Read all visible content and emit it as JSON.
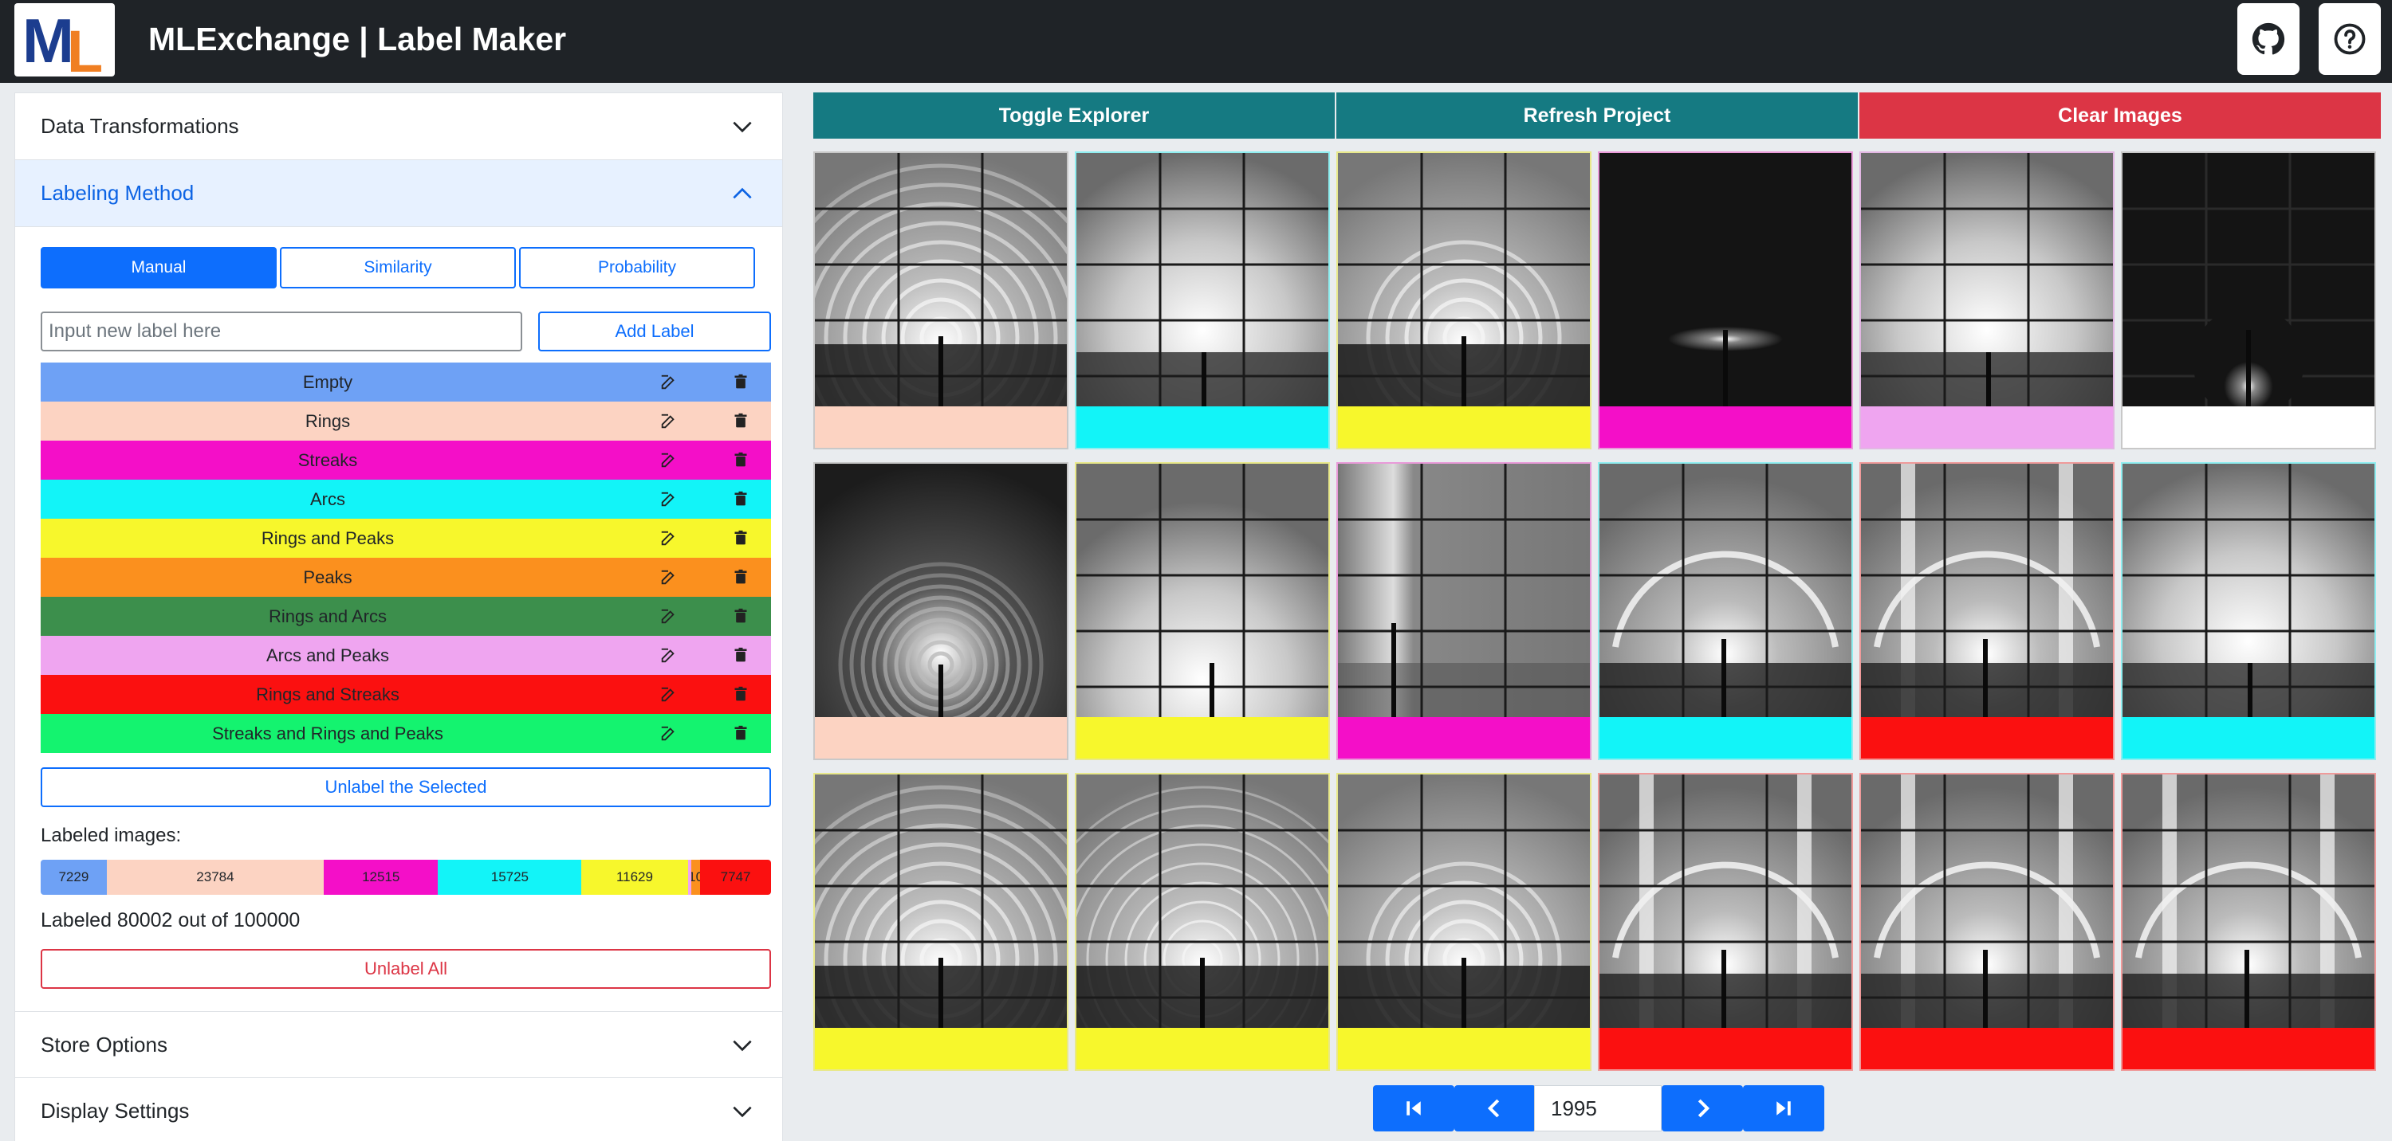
{
  "header": {
    "title": "MLExchange | Label Maker",
    "logo_m": "M",
    "logo_l": "L",
    "github_icon": "github-icon",
    "help_icon": "help-icon"
  },
  "sidebar": {
    "sections": {
      "data_transformations": "Data Transformations",
      "labeling_method": "Labeling Method",
      "store_options": "Store Options",
      "display_settings": "Display Settings"
    },
    "methods": [
      "Manual",
      "Similarity",
      "Probability"
    ],
    "active_method": "Manual",
    "new_label_placeholder": "Input new label here",
    "add_label": "Add Label",
    "labels": [
      {
        "name": "Empty",
        "color": "#6ea1f5"
      },
      {
        "name": "Rings",
        "color": "#fcd3c2"
      },
      {
        "name": "Streaks",
        "color": "#f40fc8"
      },
      {
        "name": "Arcs",
        "color": "#12f4f8"
      },
      {
        "name": "Rings and Peaks",
        "color": "#f7f72c"
      },
      {
        "name": "Peaks",
        "color": "#fb901e"
      },
      {
        "name": "Rings and Arcs",
        "color": "#3c8f4c"
      },
      {
        "name": "Arcs and Peaks",
        "color": "#efa5f0"
      },
      {
        "name": "Rings and Streaks",
        "color": "#fb1010"
      },
      {
        "name": "Streaks and Rings and Peaks",
        "color": "#14f36f"
      }
    ],
    "unlabel_selected": "Unlabel the Selected",
    "labeled_images_title": "Labeled images:",
    "label_counts": [
      {
        "label": "7229",
        "value": 7229,
        "color": "#6ea1f5"
      },
      {
        "label": "23784",
        "value": 23784,
        "color": "#fcd3c2"
      },
      {
        "label": "12515",
        "value": 12515,
        "color": "#f40fc8"
      },
      {
        "label": "15725",
        "value": 15725,
        "color": "#12f4f8"
      },
      {
        "label": "11629",
        "value": 11629,
        "color": "#f7f72c"
      },
      {
        "label": "",
        "value": 393,
        "color": "#efa5f0"
      },
      {
        "label": "10",
        "value": 980,
        "color": "#fb901e"
      },
      {
        "label": "7747",
        "value": 7747,
        "color": "#fb1010"
      }
    ],
    "labeled_summary": "Labeled 80002 out of 100000",
    "unlabel_all": "Unlabel All"
  },
  "toolbar": {
    "toggle_explorer": "Toggle Explorer",
    "refresh_project": "Refresh Project",
    "clear_images": "Clear Images",
    "teal": "#157a82",
    "red": "#dc3545"
  },
  "grid": [
    {
      "pattern": "rings-dense",
      "label_color": "#fcd3c2",
      "border": "#c8c8c8"
    },
    {
      "pattern": "glow-beam",
      "label_color": "#12f4f8",
      "border": "#8feef0"
    },
    {
      "pattern": "rings-faint",
      "label_color": "#f7f72c",
      "border": "#e8e88a"
    },
    {
      "pattern": "streak-dark",
      "label_color": "#f40fc8",
      "border": "#e99ad9"
    },
    {
      "pattern": "glow-beam",
      "label_color": "#efa5f0",
      "border": "#e2b6e3"
    },
    {
      "pattern": "dark-spot",
      "label_color": "#ffffff",
      "border": "#c8c8c8"
    },
    {
      "pattern": "rings-dark",
      "label_color": "#fcd3c2",
      "border": "#c8c8c8"
    },
    {
      "pattern": "glow-low",
      "label_color": "#f7f72c",
      "border": "#e8e88a"
    },
    {
      "pattern": "streak-vertical",
      "label_color": "#f40fc8",
      "border": "#e99ad9"
    },
    {
      "pattern": "arcs",
      "label_color": "#12f4f8",
      "border": "#8feef0"
    },
    {
      "pattern": "arcs-streak",
      "label_color": "#fb1010",
      "border": "#ef9a9a"
    },
    {
      "pattern": "glow-beam",
      "label_color": "#12f4f8",
      "border": "#8feef0"
    },
    {
      "pattern": "rings-dense",
      "label_color": "#f7f72c",
      "border": "#e8e88a"
    },
    {
      "pattern": "rings-soft",
      "label_color": "#f7f72c",
      "border": "#e8e88a"
    },
    {
      "pattern": "rings-faint",
      "label_color": "#f7f72c",
      "border": "#e8e88a"
    },
    {
      "pattern": "arcs-streak",
      "label_color": "#fb1010",
      "border": "#ef9a9a"
    },
    {
      "pattern": "arcs-streak",
      "label_color": "#fb1010",
      "border": "#ef9a9a"
    },
    {
      "pattern": "arcs-streak",
      "label_color": "#fb1010",
      "border": "#ef9a9a"
    }
  ],
  "pagination": {
    "page": "1995",
    "first_icon": "first-page-icon",
    "prev_icon": "prev-page-icon",
    "next_icon": "next-page-icon",
    "last_icon": "last-page-icon"
  }
}
